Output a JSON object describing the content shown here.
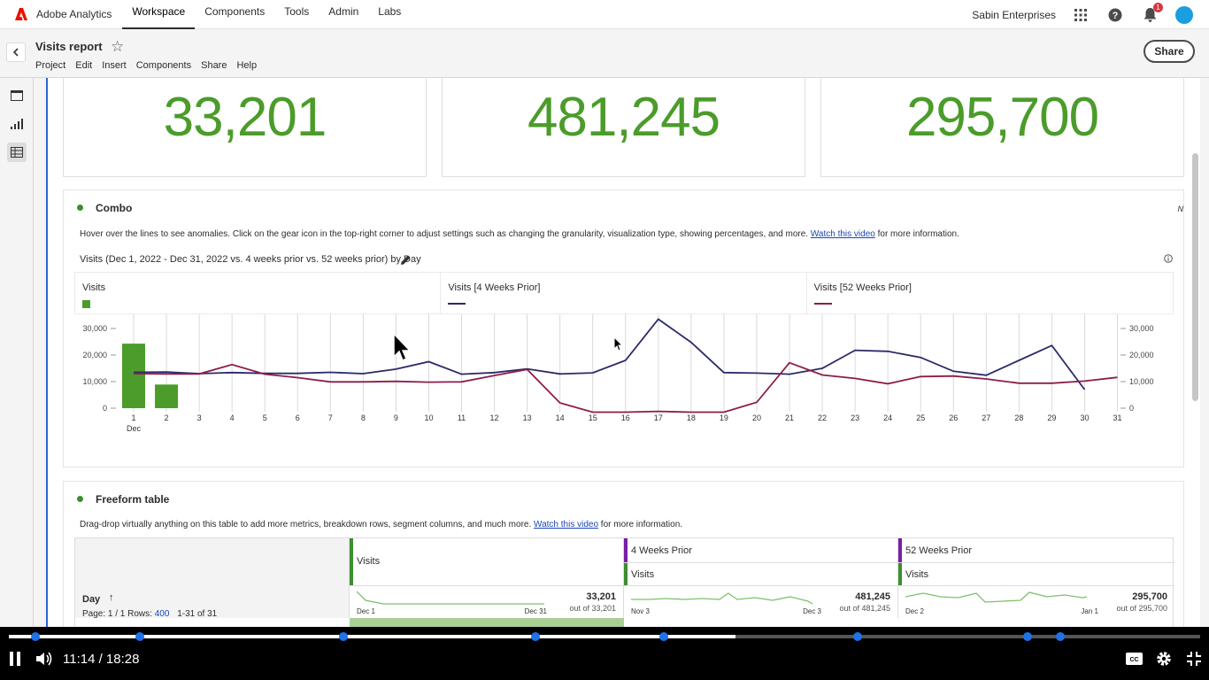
{
  "topnav": {
    "app_name": "Adobe Analytics",
    "items": [
      "Workspace",
      "Components",
      "Tools",
      "Admin",
      "Labs"
    ],
    "active": "Workspace",
    "org": "Sabin Enterprises",
    "notification_count": "1"
  },
  "project": {
    "title": "Visits report",
    "menu": [
      "Project",
      "Edit",
      "Insert",
      "Components",
      "Share",
      "Help"
    ],
    "share_label": "Share"
  },
  "kpis": [
    "33,201",
    "481,245",
    "295,700"
  ],
  "combo": {
    "title": "Combo",
    "desc_text": "Hover over the lines to see anomalies. Click on the gear icon in the top-right corner to adjust settings such as changing the granularity, visualization type, showing percentages, and more.",
    "desc_link": "Watch this video",
    "desc_tail": "for more information.",
    "chart_heading": "Visits (Dec 1, 2022 - Dec 31, 2022 vs. 4 weeks prior vs. 52 weeks prior) by Day",
    "corner_label": "N",
    "legend": [
      "Visits",
      "Visits [4 Weeks Prior]",
      "Visits [52 Weeks Prior]"
    ],
    "colors": {
      "visits": "#4b9c2a",
      "prior4": "#2b2a6b",
      "prior52": "#8c1d4a"
    }
  },
  "chart_data": {
    "type": "bar",
    "categories": [
      "1",
      "2",
      "3",
      "4",
      "5",
      "6",
      "7",
      "8",
      "9",
      "10",
      "11",
      "12",
      "13",
      "14",
      "15",
      "16",
      "17",
      "18",
      "19",
      "20",
      "21",
      "22",
      "23",
      "24",
      "25",
      "26",
      "27",
      "28",
      "29",
      "30",
      "31"
    ],
    "x_sublabel": "Dec",
    "y_ticks": [
      "30,000",
      "20,000",
      "10,000",
      "0"
    ],
    "ylim": [
      0,
      30000
    ],
    "series": [
      {
        "name": "Visits",
        "type": "bar",
        "values": [
          24300,
          8900,
          null,
          null,
          null,
          null,
          null,
          null,
          null,
          null,
          null,
          null,
          null,
          null,
          null,
          null,
          null,
          null,
          null,
          null,
          null,
          null,
          null,
          null,
          null,
          null,
          null,
          null,
          null,
          null,
          null
        ]
      },
      {
        "name": "Visits [4 Weeks Prior]",
        "type": "line",
        "values": [
          13500,
          13600,
          13000,
          13400,
          13100,
          13100,
          13500,
          13000,
          14700,
          17500,
          12800,
          13400,
          14800,
          12900,
          13300,
          18000,
          33500,
          24800,
          13400,
          13200,
          12800,
          15000,
          21800,
          21400,
          19100,
          13900,
          12400,
          18000,
          23600,
          7000,
          null
        ]
      },
      {
        "name": "Visits [52 Weeks Prior]",
        "type": "line",
        "values": [
          13000,
          12900,
          12900,
          16400,
          12800,
          11500,
          9900,
          9900,
          10100,
          9800,
          9900,
          12300,
          14600,
          2000,
          -1500,
          -1500,
          -1200,
          -1500,
          -1500,
          2200,
          17100,
          12500,
          11200,
          9200,
          11900,
          12100,
          11000,
          9400,
          9400,
          10200,
          11600
        ]
      }
    ],
    "grid": true
  },
  "freeform": {
    "title": "Freeform table",
    "desc_text": "Drag-drop virtually anything on this table to add more metrics, breakdown rows, segment columns, and much more.",
    "desc_link": "Watch this video",
    "desc_tail": "for more information.",
    "row_label": "Day",
    "page_text": "Page: 1 / 1 Rows:",
    "rows_value": "400",
    "range_text": "1-31 of 31",
    "columns": [
      {
        "segment": "",
        "metric": "Visits",
        "total": "33,201",
        "out_of": "out of 33,201",
        "date_start": "Dec 1",
        "date_end": "Dec 31"
      },
      {
        "segment": "4 Weeks Prior",
        "metric": "Visits",
        "total": "481,245",
        "out_of": "out of 481,245",
        "date_start": "Nov 3",
        "date_end": "Dec 3"
      },
      {
        "segment": "52 Weeks Prior",
        "metric": "Visits",
        "total": "295,700",
        "out_of": "out of 295,700",
        "date_start": "Dec 2",
        "date_end": "Jan 1"
      }
    ]
  },
  "video": {
    "time": "11:14 / 18:28",
    "progress": 0.61
  }
}
